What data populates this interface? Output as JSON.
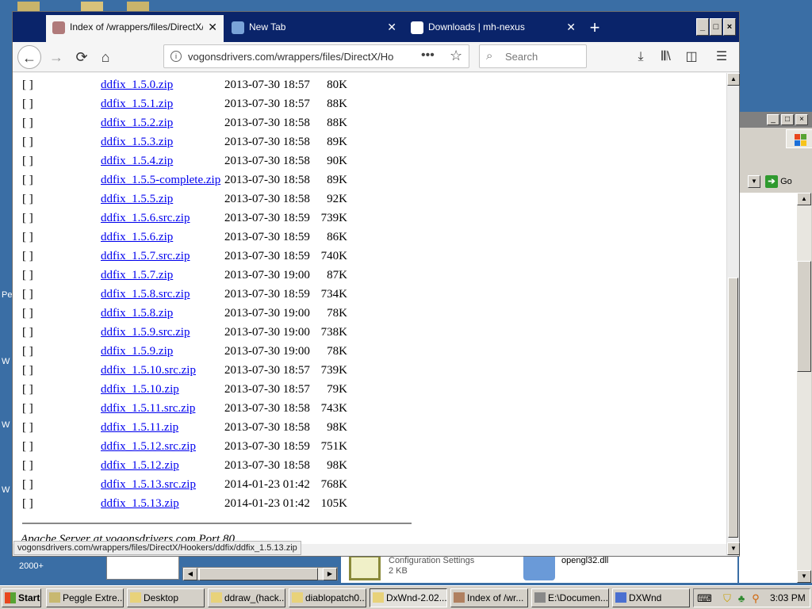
{
  "desktop": {
    "icon_labels": [
      "2000+",
      "Pe",
      "W",
      "W",
      "W"
    ]
  },
  "bg_window": {
    "go_label": "Go",
    "files": [
      {
        "name": "Configuration Settings",
        "size": "2 KB"
      },
      {
        "name": "opengl32.dll",
        "size": ""
      }
    ]
  },
  "browser": {
    "tabs": [
      {
        "label": "Index of /wrappers/files/DirectX/H",
        "active": true
      },
      {
        "label": "New Tab",
        "active": false
      },
      {
        "label": "Downloads | mh-nexus",
        "active": false
      }
    ],
    "newtab_symbol": "+",
    "window_controls": [
      "_",
      "□",
      "×"
    ],
    "url": "vogonsdrivers.com/wrappers/files/DirectX/Ho",
    "search_placeholder": "Search",
    "status_url": "vogonsdrivers.com/wrappers/files/DirectX/Hookers/ddfix/ddfix_1.5.13.zip",
    "footer_text": "Apache Server at vogonsdrivers.com Port 80"
  },
  "listing": {
    "checkbox_text": "[ ]",
    "rows": [
      {
        "name": "ddfix_1.5.0.zip",
        "date": "2013-07-30 18:57",
        "size": "80K"
      },
      {
        "name": "ddfix_1.5.1.zip",
        "date": "2013-07-30 18:57",
        "size": "88K"
      },
      {
        "name": "ddfix_1.5.2.zip",
        "date": "2013-07-30 18:58",
        "size": "88K"
      },
      {
        "name": "ddfix_1.5.3.zip",
        "date": "2013-07-30 18:58",
        "size": "89K"
      },
      {
        "name": "ddfix_1.5.4.zip",
        "date": "2013-07-30 18:58",
        "size": "90K"
      },
      {
        "name": "ddfix_1.5.5-complete.zip",
        "date": "2013-07-30 18:58",
        "size": "89K"
      },
      {
        "name": "ddfix_1.5.5.zip",
        "date": "2013-07-30 18:58",
        "size": "92K"
      },
      {
        "name": "ddfix_1.5.6.src.zip",
        "date": "2013-07-30 18:59",
        "size": "739K"
      },
      {
        "name": "ddfix_1.5.6.zip",
        "date": "2013-07-30 18:59",
        "size": "86K"
      },
      {
        "name": "ddfix_1.5.7.src.zip",
        "date": "2013-07-30 18:59",
        "size": "740K"
      },
      {
        "name": "ddfix_1.5.7.zip",
        "date": "2013-07-30 19:00",
        "size": "87K"
      },
      {
        "name": "ddfix_1.5.8.src.zip",
        "date": "2013-07-30 18:59",
        "size": "734K"
      },
      {
        "name": "ddfix_1.5.8.zip",
        "date": "2013-07-30 19:00",
        "size": "78K"
      },
      {
        "name": "ddfix_1.5.9.src.zip",
        "date": "2013-07-30 19:00",
        "size": "738K"
      },
      {
        "name": "ddfix_1.5.9.zip",
        "date": "2013-07-30 19:00",
        "size": "78K"
      },
      {
        "name": "ddfix_1.5.10.src.zip",
        "date": "2013-07-30 18:57",
        "size": "739K"
      },
      {
        "name": "ddfix_1.5.10.zip",
        "date": "2013-07-30 18:57",
        "size": "79K"
      },
      {
        "name": "ddfix_1.5.11.src.zip",
        "date": "2013-07-30 18:58",
        "size": "743K"
      },
      {
        "name": "ddfix_1.5.11.zip",
        "date": "2013-07-30 18:58",
        "size": "98K"
      },
      {
        "name": "ddfix_1.5.12.src.zip",
        "date": "2013-07-30 18:59",
        "size": "751K"
      },
      {
        "name": "ddfix_1.5.12.zip",
        "date": "2013-07-30 18:58",
        "size": "98K"
      },
      {
        "name": "ddfix_1.5.13.src.zip",
        "date": "2014-01-23 01:42",
        "size": "768K"
      },
      {
        "name": "ddfix_1.5.13.zip",
        "date": "2014-01-23 01:42",
        "size": "105K"
      }
    ]
  },
  "taskbar": {
    "start_label": "Start",
    "tasks": [
      {
        "label": "Peggle Extre..."
      },
      {
        "label": "Desktop"
      },
      {
        "label": "ddraw_(hack..."
      },
      {
        "label": "diablopatch0..."
      },
      {
        "label": "DxWnd-2.02..."
      },
      {
        "label": "Index of /wr..."
      },
      {
        "label": "E:\\Documen..."
      },
      {
        "label": "DXWnd"
      }
    ],
    "clock": "3:03 PM"
  },
  "colors": {
    "link": "#0000ee",
    "tabbar": "#0a246a",
    "desktop": "#3a6ea5",
    "win_face": "#d4d0c8"
  }
}
